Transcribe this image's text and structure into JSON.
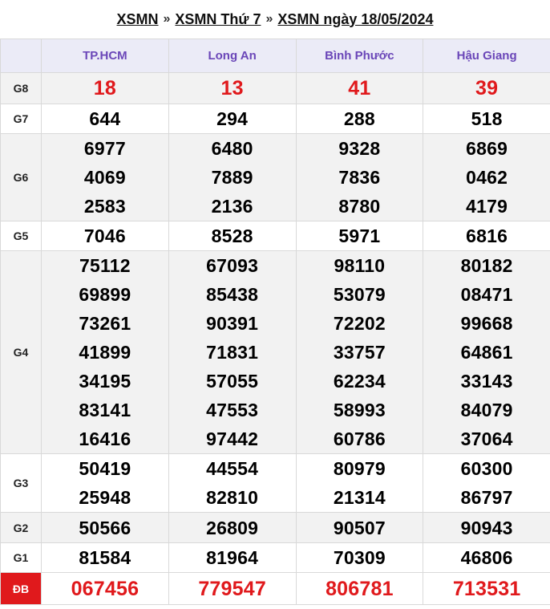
{
  "breadcrumb": {
    "items": [
      "XSMN",
      "XSMN Thứ 7",
      "XSMN ngày 18/05/2024"
    ],
    "separator": "»"
  },
  "provinces": [
    "TP.HCM",
    "Long An",
    "Bình Phước",
    "Hậu Giang"
  ],
  "prizes": [
    {
      "label": "G8",
      "shade": true,
      "highlight": true,
      "values": [
        [
          "18"
        ],
        [
          "13"
        ],
        [
          "41"
        ],
        [
          "39"
        ]
      ]
    },
    {
      "label": "G7",
      "shade": false,
      "highlight": false,
      "values": [
        [
          "644"
        ],
        [
          "294"
        ],
        [
          "288"
        ],
        [
          "518"
        ]
      ]
    },
    {
      "label": "G6",
      "shade": true,
      "highlight": false,
      "values": [
        [
          "6977",
          "4069",
          "2583"
        ],
        [
          "6480",
          "7889",
          "2136"
        ],
        [
          "9328",
          "7836",
          "8780"
        ],
        [
          "6869",
          "0462",
          "4179"
        ]
      ]
    },
    {
      "label": "G5",
      "shade": false,
      "highlight": false,
      "values": [
        [
          "7046"
        ],
        [
          "8528"
        ],
        [
          "5971"
        ],
        [
          "6816"
        ]
      ]
    },
    {
      "label": "G4",
      "shade": true,
      "highlight": false,
      "values": [
        [
          "75112",
          "69899",
          "73261",
          "41899",
          "34195",
          "83141",
          "16416"
        ],
        [
          "67093",
          "85438",
          "90391",
          "71831",
          "57055",
          "47553",
          "97442"
        ],
        [
          "98110",
          "53079",
          "72202",
          "33757",
          "62234",
          "58993",
          "60786"
        ],
        [
          "80182",
          "08471",
          "99668",
          "64861",
          "33143",
          "84079",
          "37064"
        ]
      ]
    },
    {
      "label": "G3",
      "shade": false,
      "highlight": false,
      "values": [
        [
          "50419",
          "25948"
        ],
        [
          "44554",
          "82810"
        ],
        [
          "80979",
          "21314"
        ],
        [
          "60300",
          "86797"
        ]
      ]
    },
    {
      "label": "G2",
      "shade": true,
      "highlight": false,
      "values": [
        [
          "50566"
        ],
        [
          "26809"
        ],
        [
          "90507"
        ],
        [
          "90943"
        ]
      ]
    },
    {
      "label": "G1",
      "shade": false,
      "highlight": false,
      "values": [
        [
          "81584"
        ],
        [
          "81964"
        ],
        [
          "70309"
        ],
        [
          "46806"
        ]
      ]
    },
    {
      "label": "ĐB",
      "shade": false,
      "highlight": true,
      "special": true,
      "values": [
        [
          "067456"
        ],
        [
          "779547"
        ],
        [
          "806781"
        ],
        [
          "713531"
        ]
      ]
    }
  ],
  "colors": {
    "header_text": "#6a46b8",
    "header_bg": "#ebebf7",
    "highlight": "#e0191c",
    "shade_bg": "#f2f2f2"
  }
}
